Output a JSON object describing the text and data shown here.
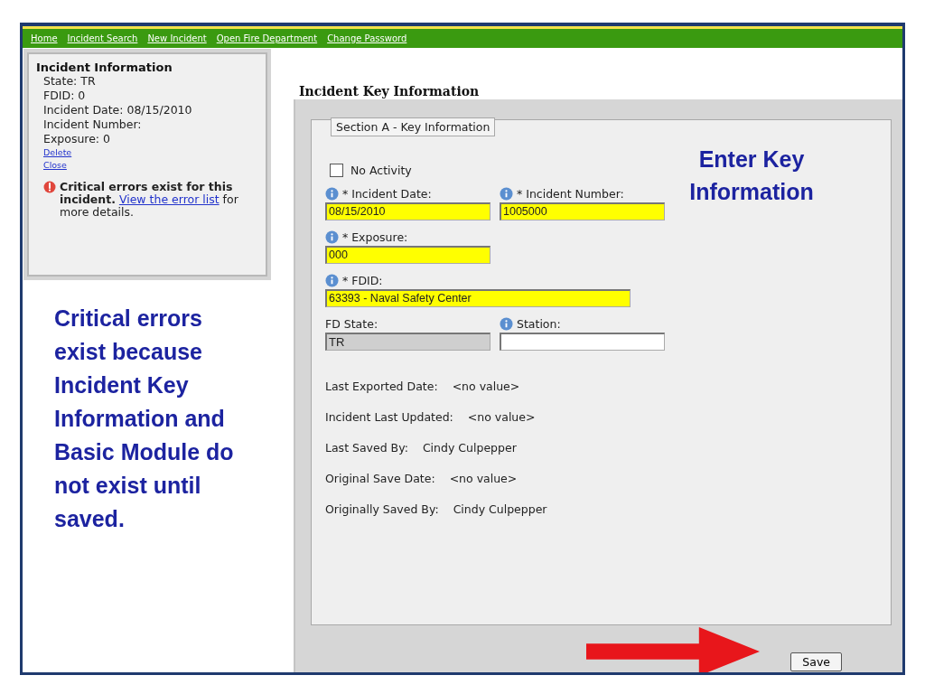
{
  "nav": [
    "Home",
    "Incident Search",
    "New Incident",
    "Open Fire Department",
    "Change Password"
  ],
  "sidebar": {
    "title": "Incident Information",
    "lines": [
      "State: TR",
      "FDID: 0",
      "Incident Date: 08/15/2010",
      "Incident Number:",
      "Exposure: 0"
    ],
    "links": [
      "Delete",
      "Close"
    ],
    "error": {
      "bold": "Critical errors exist for this incident.",
      "link": "View the error list",
      "rest": "for more details."
    }
  },
  "left_annotation": "Critical errors exist because Incident Key Information and Basic Module do not exist until saved.",
  "heading": "Incident Key Information",
  "section": {
    "legend": "Section A - Key Information",
    "checkbox": {
      "label": "No Activity",
      "checked": false
    },
    "field_rows": [
      [
        {
          "label": "* Incident Date:",
          "value": "08/15/2010",
          "info": true,
          "required": true,
          "disabled": false,
          "wide": false
        },
        {
          "label": "* Incident Number:",
          "value": "1005000",
          "info": true,
          "required": true,
          "disabled": false,
          "wide": false
        }
      ],
      [
        {
          "label": "* Exposure:",
          "value": "000",
          "info": true,
          "required": true,
          "disabled": false,
          "wide": false
        }
      ],
      [
        {
          "label": "* FDID:",
          "value": "63393 - Naval Safety Center",
          "info": true,
          "required": true,
          "disabled": false,
          "wide": true
        }
      ],
      [
        {
          "label": "FD State:",
          "value": "TR",
          "info": false,
          "required": false,
          "disabled": true,
          "wide": false
        },
        {
          "label": "Station:",
          "info": true,
          "required": false,
          "disabled": false,
          "wide": false
        }
      ]
    ],
    "info_rows": [
      {
        "label": "Last Exported Date:",
        "value": "<no value>"
      },
      {
        "label": "Incident Last Updated:",
        "value": "<no value>"
      },
      {
        "label": "Last Saved By:",
        "value": "Cindy Culpepper"
      },
      {
        "label": "Original Save Date:",
        "value": "<no value>"
      },
      {
        "label": "Originally Saved By:",
        "value": "Cindy Culpepper"
      }
    ]
  },
  "right_annotation": "Enter Key Information",
  "save_button": "Save"
}
